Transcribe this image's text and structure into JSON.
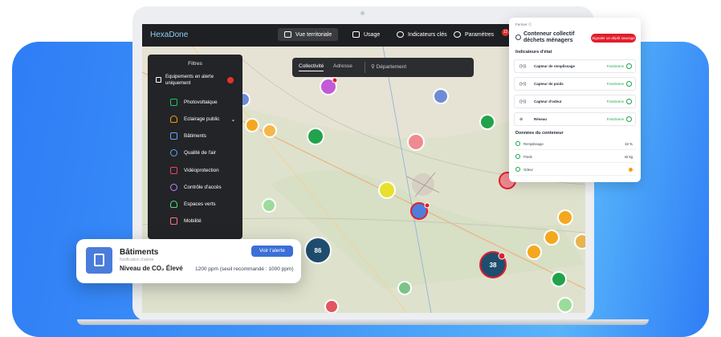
{
  "nav": {
    "logo": "HexaDone",
    "items": [
      "Vue territoriale",
      "Usage",
      "Indicateurs clés",
      "Paramètres"
    ],
    "notif_count": "12"
  },
  "segment": {
    "tabs": [
      "Collectivité",
      "Adresse"
    ],
    "search_placeholder": "Département"
  },
  "filters": {
    "title": "Filtres",
    "alert_label": "Equipements en alerte uniquement",
    "items": [
      {
        "label": "Photovoltaique",
        "color": "#22c55e"
      },
      {
        "label": "Eclairage public",
        "color": "#f59e0b"
      },
      {
        "label": "Bâtiments",
        "color": "#60a5fa"
      },
      {
        "label": "Qualité de l'air",
        "color": "#60a5fa"
      },
      {
        "label": "Vidéoprotection",
        "color": "#f43f5e"
      },
      {
        "label": "Contrôle d'accès",
        "color": "#c084fc"
      },
      {
        "label": "Espaces verts",
        "color": "#4ade80"
      },
      {
        "label": "Mobilité",
        "color": "#fb7185"
      }
    ]
  },
  "panel": {
    "close": "Fermer ⓧ",
    "title": "Conteneur collectif déchets ménagers",
    "report_button": "Signaler un dépôt sauvage",
    "state_heading": "Indicateurs d'état",
    "sensors": [
      {
        "label": "Capteur de remplissage",
        "status": "Fonctionne"
      },
      {
        "label": "Capteur de poids",
        "status": "Fonctionne"
      },
      {
        "label": "Capteur d'odeur",
        "status": "Fonctionne"
      },
      {
        "label": "Réseau",
        "status": "Fonctionne"
      }
    ],
    "data_heading": "Données du conteneur",
    "data": [
      {
        "label": "Remplissage",
        "value": "42 %"
      },
      {
        "label": "Poids",
        "value": "42 kg"
      },
      {
        "label": "Odeur",
        "value": ""
      }
    ]
  },
  "alert_card": {
    "title": "Bâtiments",
    "subtitle": "Notification d'alerte",
    "main": "Niveau de CO₂ Élevé",
    "ppm": "1200 ppm (seuil recommandé : 1000 ppm)",
    "button": "Voir l'alerte"
  },
  "clusters": {
    "a": "86",
    "b": "38"
  },
  "colors": {
    "accent": "#3b6fd6",
    "alert": "#e21d2d",
    "ok": "#16a34a",
    "band": "#3f96f8"
  }
}
